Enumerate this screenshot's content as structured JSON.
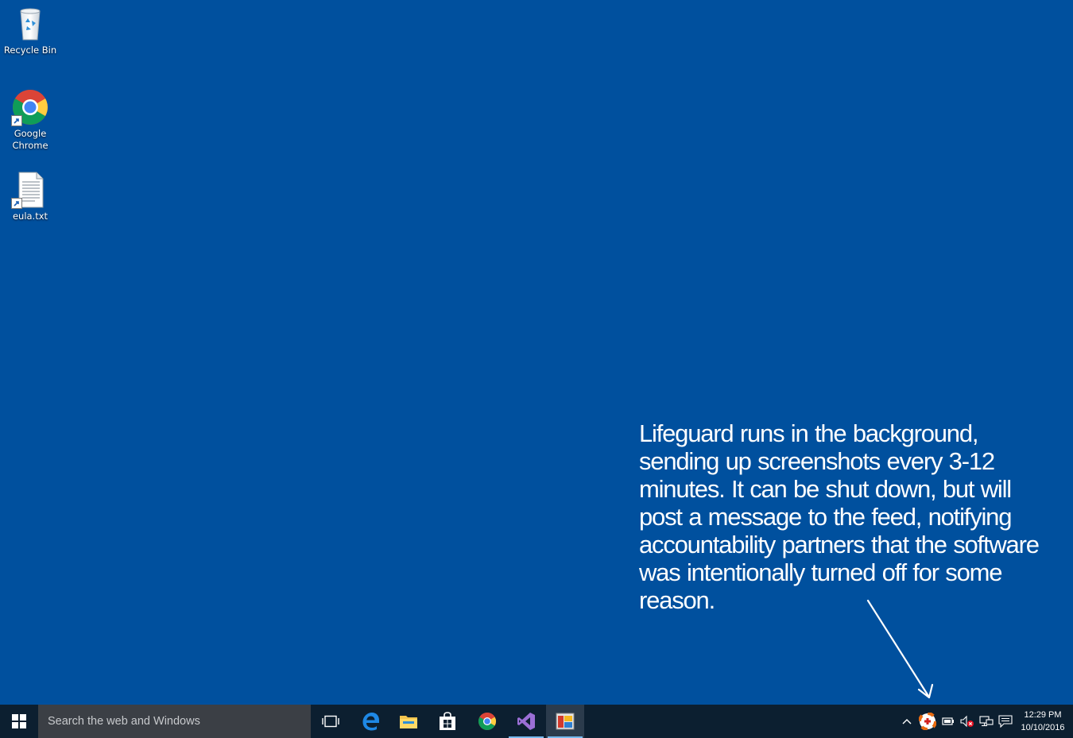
{
  "desktop": {
    "background_color": "#00509e",
    "icons": [
      {
        "label": "Recycle Bin",
        "icon": "recycle-bin-icon"
      },
      {
        "label": "Google Chrome",
        "icon": "chrome-icon"
      },
      {
        "label": "eula.txt",
        "icon": "text-file-icon"
      }
    ]
  },
  "annotation": {
    "text": "Lifeguard runs in the background, sending up screenshots every 3-12 minutes.  It can be shut down, but will post a message to the feed, notifying accountability partners that the software was intentionally turned off for some reason."
  },
  "taskbar": {
    "background_color": "#0c1f30",
    "accent_color": "#76b9ed",
    "start_icon": "windows-logo-icon",
    "search_placeholder": "Search the web and Windows",
    "pinned": [
      {
        "icon": "task-view-icon",
        "active": false
      },
      {
        "icon": "edge-icon",
        "active": false
      },
      {
        "icon": "file-explorer-icon",
        "active": false
      },
      {
        "icon": "store-icon",
        "active": false
      },
      {
        "icon": "chrome-icon",
        "active": false
      },
      {
        "icon": "visual-studio-icon",
        "active": true
      },
      {
        "icon": "lifeguard-app-icon",
        "active": true
      }
    ],
    "tray": [
      {
        "icon": "show-hidden-icons-chevron-icon"
      },
      {
        "icon": "lifeguard-tray-icon"
      },
      {
        "icon": "battery-icon"
      },
      {
        "icon": "volume-muted-icon"
      },
      {
        "icon": "network-icon"
      },
      {
        "icon": "action-center-icon"
      }
    ],
    "clock": {
      "time": "12:29 PM",
      "date": "10/10/2016"
    }
  }
}
